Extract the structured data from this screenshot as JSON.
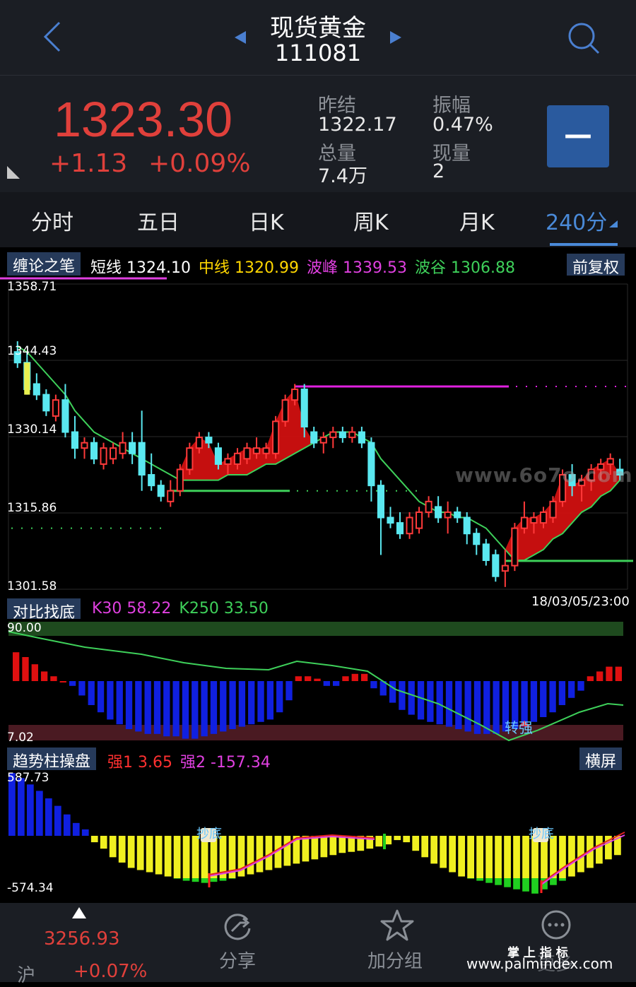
{
  "header": {
    "title": "现货黄金",
    "code": "111081"
  },
  "quote": {
    "price": "1323.30",
    "change": "+1.13",
    "change_pct": "+0.09%",
    "prev_close_label": "昨结",
    "prev_close": "1322.17",
    "amplitude_label": "振幅",
    "amplitude": "0.47%",
    "volume_label": "总量",
    "volume": "7.4万",
    "current_volume_label": "现量",
    "current_volume": "2",
    "remove_button": "—"
  },
  "tabs": [
    "分时",
    "五日",
    "日K",
    "周K",
    "月K",
    "240分"
  ],
  "main_chart": {
    "indicator_name": "缠论之笔",
    "short_label": "短线",
    "short_value": "1324.10",
    "mid_label": "中线",
    "mid_value": "1320.99",
    "peak_label": "波峰",
    "peak_value": "1339.53",
    "trough_label": "波谷",
    "trough_value": "1306.88",
    "adjust_button": "前复权",
    "y_ticks": [
      "1358.71",
      "1344.43",
      "1330.14",
      "1315.86",
      "1301.58"
    ],
    "date_label": "18/03/05/23:00",
    "watermark": "www.6o7o.com"
  },
  "sub_chart_1": {
    "indicator_name": "对比找底",
    "k30_label": "K30",
    "k30_value": "58.22",
    "k250_label": "K250",
    "k250_value": "33.50",
    "y_top": "90.00",
    "y_bottom": "7.02",
    "annotation": "转强"
  },
  "sub_chart_2": {
    "indicator_name": "趋势柱操盘",
    "strong1_label": "强1",
    "strong1_value": "3.65",
    "strong2_label": "强2",
    "strong2_value": "-157.34",
    "landscape_button": "横屏",
    "y_top": "587.73",
    "y_bottom": "-574.34",
    "annotation": "抄底"
  },
  "footer": {
    "index_value": "3256.93",
    "index_name": "沪",
    "index_change": "+0.07%",
    "share_label": "分享",
    "add_group_label": "加分组",
    "more_label": "更多",
    "brand_cn": "掌 上 指 标",
    "brand_url": "www.palmindex.com"
  },
  "chart_data": [
    {
      "type": "candlestick",
      "ylim": [
        1301.58,
        1358.71
      ],
      "ohlc": [
        [
          1346,
          1348,
          1343,
          1344
        ],
        [
          1344,
          1346,
          1338,
          1339
        ],
        [
          1340,
          1342,
          1337,
          1338
        ],
        [
          1338,
          1339,
          1334,
          1335
        ],
        [
          1334,
          1338,
          1333,
          1337
        ],
        [
          1337,
          1340,
          1330,
          1331
        ],
        [
          1331,
          1334,
          1326,
          1328
        ],
        [
          1328,
          1330,
          1326,
          1329
        ],
        [
          1329,
          1330,
          1325,
          1326
        ],
        [
          1325,
          1329,
          1324,
          1328
        ],
        [
          1326,
          1329,
          1325,
          1328
        ],
        [
          1327,
          1331,
          1326,
          1329
        ],
        [
          1329,
          1331,
          1325,
          1327
        ],
        [
          1329,
          1335,
          1320,
          1323
        ],
        [
          1323,
          1327,
          1320,
          1321
        ],
        [
          1321,
          1322,
          1318,
          1319
        ],
        [
          1318,
          1322,
          1317,
          1320
        ],
        [
          1320,
          1325,
          1319,
          1324
        ],
        [
          1324,
          1329,
          1323,
          1328
        ],
        [
          1328,
          1331,
          1327,
          1330
        ],
        [
          1330,
          1331,
          1328,
          1329
        ],
        [
          1328,
          1329,
          1324,
          1325
        ],
        [
          1325,
          1327,
          1323,
          1326
        ],
        [
          1325,
          1328,
          1324,
          1327
        ],
        [
          1326,
          1329,
          1325,
          1328
        ],
        [
          1327,
          1330,
          1326,
          1328
        ],
        [
          1327,
          1329,
          1326,
          1328
        ],
        [
          1327,
          1334,
          1326,
          1333
        ],
        [
          1333,
          1338,
          1332,
          1337
        ],
        [
          1337,
          1340,
          1336,
          1339
        ],
        [
          1339,
          1340,
          1330,
          1332
        ],
        [
          1331,
          1332,
          1328,
          1329
        ],
        [
          1329,
          1331,
          1327,
          1330
        ],
        [
          1330,
          1332,
          1328,
          1331
        ],
        [
          1331,
          1332,
          1329,
          1330
        ],
        [
          1330,
          1332,
          1329,
          1331
        ],
        [
          1331,
          1332,
          1328,
          1329
        ],
        [
          1329,
          1330,
          1318,
          1321
        ],
        [
          1321,
          1322,
          1308,
          1315
        ],
        [
          1315,
          1317,
          1313,
          1314
        ],
        [
          1314,
          1316,
          1311,
          1312
        ],
        [
          1312,
          1316,
          1311,
          1315
        ],
        [
          1313,
          1317,
          1312,
          1316
        ],
        [
          1316,
          1319,
          1315,
          1318
        ],
        [
          1317,
          1319,
          1314,
          1315
        ],
        [
          1315,
          1318,
          1312,
          1316
        ],
        [
          1316,
          1317,
          1314,
          1315
        ],
        [
          1315,
          1316,
          1310,
          1312
        ],
        [
          1312,
          1313,
          1308,
          1310
        ],
        [
          1310,
          1311,
          1306,
          1307
        ],
        [
          1308,
          1309,
          1303,
          1304
        ],
        [
          1305,
          1309,
          1302,
          1306
        ],
        [
          1306,
          1314,
          1305,
          1313
        ],
        [
          1313,
          1318,
          1312,
          1315
        ],
        [
          1314,
          1316,
          1312,
          1315
        ],
        [
          1314,
          1317,
          1313,
          1316
        ],
        [
          1315,
          1319,
          1314,
          1318
        ],
        [
          1318,
          1324,
          1317,
          1323
        ],
        [
          1323,
          1325,
          1319,
          1321
        ],
        [
          1321,
          1323,
          1318,
          1322
        ],
        [
          1322,
          1325,
          1320,
          1324
        ],
        [
          1324,
          1326,
          1322,
          1325
        ],
        [
          1325,
          1327,
          1323,
          1326
        ],
        [
          1324,
          1326,
          1322,
          1323
        ]
      ],
      "ma": [
        1347,
        1346,
        1344,
        1342,
        1340,
        1338,
        1335,
        1333,
        1331,
        1330,
        1329,
        1328,
        1327,
        1326,
        1325,
        1324,
        1323,
        1322,
        1322,
        1322,
        1322,
        1322,
        1323,
        1323,
        1323,
        1324,
        1325,
        1325,
        1326,
        1327,
        1328,
        1329,
        1330,
        1331,
        1331,
        1331,
        1330,
        1329,
        1326,
        1324,
        1322,
        1320,
        1318,
        1317,
        1316,
        1316,
        1315,
        1315,
        1314,
        1313,
        1311,
        1309,
        1307,
        1307,
        1308,
        1309,
        1311,
        1312,
        1314,
        1316,
        1317,
        1319,
        1320,
        1322
      ],
      "resistance_level": 1339.53,
      "support_levels": [
        1320,
        1306.88
      ]
    },
    {
      "type": "bar",
      "ylim": [
        7.02,
        90.0
      ],
      "series": [
        {
          "values": [
            12,
            10,
            7,
            4,
            2,
            0,
            -2,
            -6,
            -10,
            -13,
            -16,
            -18,
            -20,
            -21,
            -22,
            -22,
            -23,
            -23,
            -24,
            -24,
            -23,
            -22,
            -21,
            -20,
            -19,
            -18,
            -17,
            -16,
            -13,
            -8,
            2,
            2,
            1,
            -2,
            -2,
            2,
            3,
            3,
            -3,
            -6,
            -9,
            -12,
            -14,
            -16,
            -17,
            -18,
            -19,
            -20,
            -21,
            -22,
            -22,
            -22,
            -21,
            -20,
            -19,
            -17,
            -15,
            -13,
            -10,
            -7,
            -4,
            2,
            4,
            6,
            6
          ]
        },
        {
          "name": "K30",
          "values": []
        },
        {
          "name": "K250",
          "values": []
        }
      ]
    },
    {
      "type": "bar",
      "ylim": [
        -574.34,
        587.73
      ],
      "series": [
        {
          "values": [
            587,
            540,
            480,
            420,
            350,
            280,
            200,
            120,
            60,
            -60,
            -120,
            -200,
            -250,
            -300,
            -320,
            -340,
            -360,
            -380,
            -400,
            -420,
            -430,
            -440,
            -430,
            -420,
            -400,
            -380,
            -360,
            -340,
            -320,
            -300,
            -280,
            -260,
            -240,
            -220,
            -200,
            -180,
            -160,
            -150,
            -140,
            -120,
            -100,
            -80,
            -40,
            -60,
            -140,
            -200,
            -260,
            -300,
            -340,
            -380,
            -400,
            -420,
            -440,
            -460,
            -480,
            -500,
            -520,
            -540,
            -500,
            -460,
            -420,
            -380,
            -340,
            -300,
            -260,
            -220,
            -180
          ]
        },
        {
          "name": "强1",
          "values": []
        },
        {
          "name": "强2",
          "values": []
        }
      ]
    }
  ]
}
